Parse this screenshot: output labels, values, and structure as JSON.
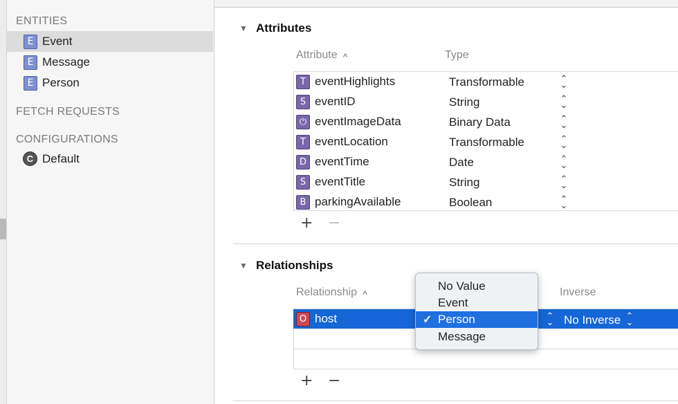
{
  "sidebar": {
    "entities_header": "ENTITIES",
    "entities": [
      {
        "icon": "E",
        "label": "Event"
      },
      {
        "icon": "E",
        "label": "Message"
      },
      {
        "icon": "E",
        "label": "Person"
      }
    ],
    "fetch_header": "FETCH REQUESTS",
    "config_header": "CONFIGURATIONS",
    "configurations": [
      {
        "icon": "C",
        "label": "Default"
      }
    ]
  },
  "attributes": {
    "title": "Attributes",
    "col_attribute": "Attribute",
    "col_type": "Type",
    "rows": [
      {
        "icon": "T",
        "name": "eventHighlights",
        "type": "Transformable"
      },
      {
        "icon": "S",
        "name": "eventID",
        "type": "String"
      },
      {
        "icon": "⏻",
        "name": "eventImageData",
        "type": "Binary Data"
      },
      {
        "icon": "T",
        "name": "eventLocation",
        "type": "Transformable"
      },
      {
        "icon": "D",
        "name": "eventTime",
        "type": "Date"
      },
      {
        "icon": "S",
        "name": "eventTitle",
        "type": "String"
      },
      {
        "icon": "B",
        "name": "parkingAvailable",
        "type": "Boolean"
      }
    ],
    "add": "+",
    "remove": "−"
  },
  "relationships": {
    "title": "Relationships",
    "col_relationship": "Relationship",
    "col_inverse": "Inverse",
    "rows": [
      {
        "icon": "O",
        "name": "host",
        "inverse": "No Inverse"
      }
    ],
    "add": "+",
    "remove": "−"
  },
  "popup": {
    "items": [
      "No Value",
      "Event",
      "Person",
      "Message"
    ],
    "selected": "Person",
    "check": "✓"
  },
  "icons": {
    "disclosure": "▼",
    "sort": "^",
    "stepper_up": "⌃",
    "stepper_down": "⌄"
  },
  "colors": {
    "selection_blue": "#1566d6",
    "entity_icon": "#7f90d0",
    "attribute_icon": "#7867a9",
    "relationship_icon": "#c84a54"
  }
}
